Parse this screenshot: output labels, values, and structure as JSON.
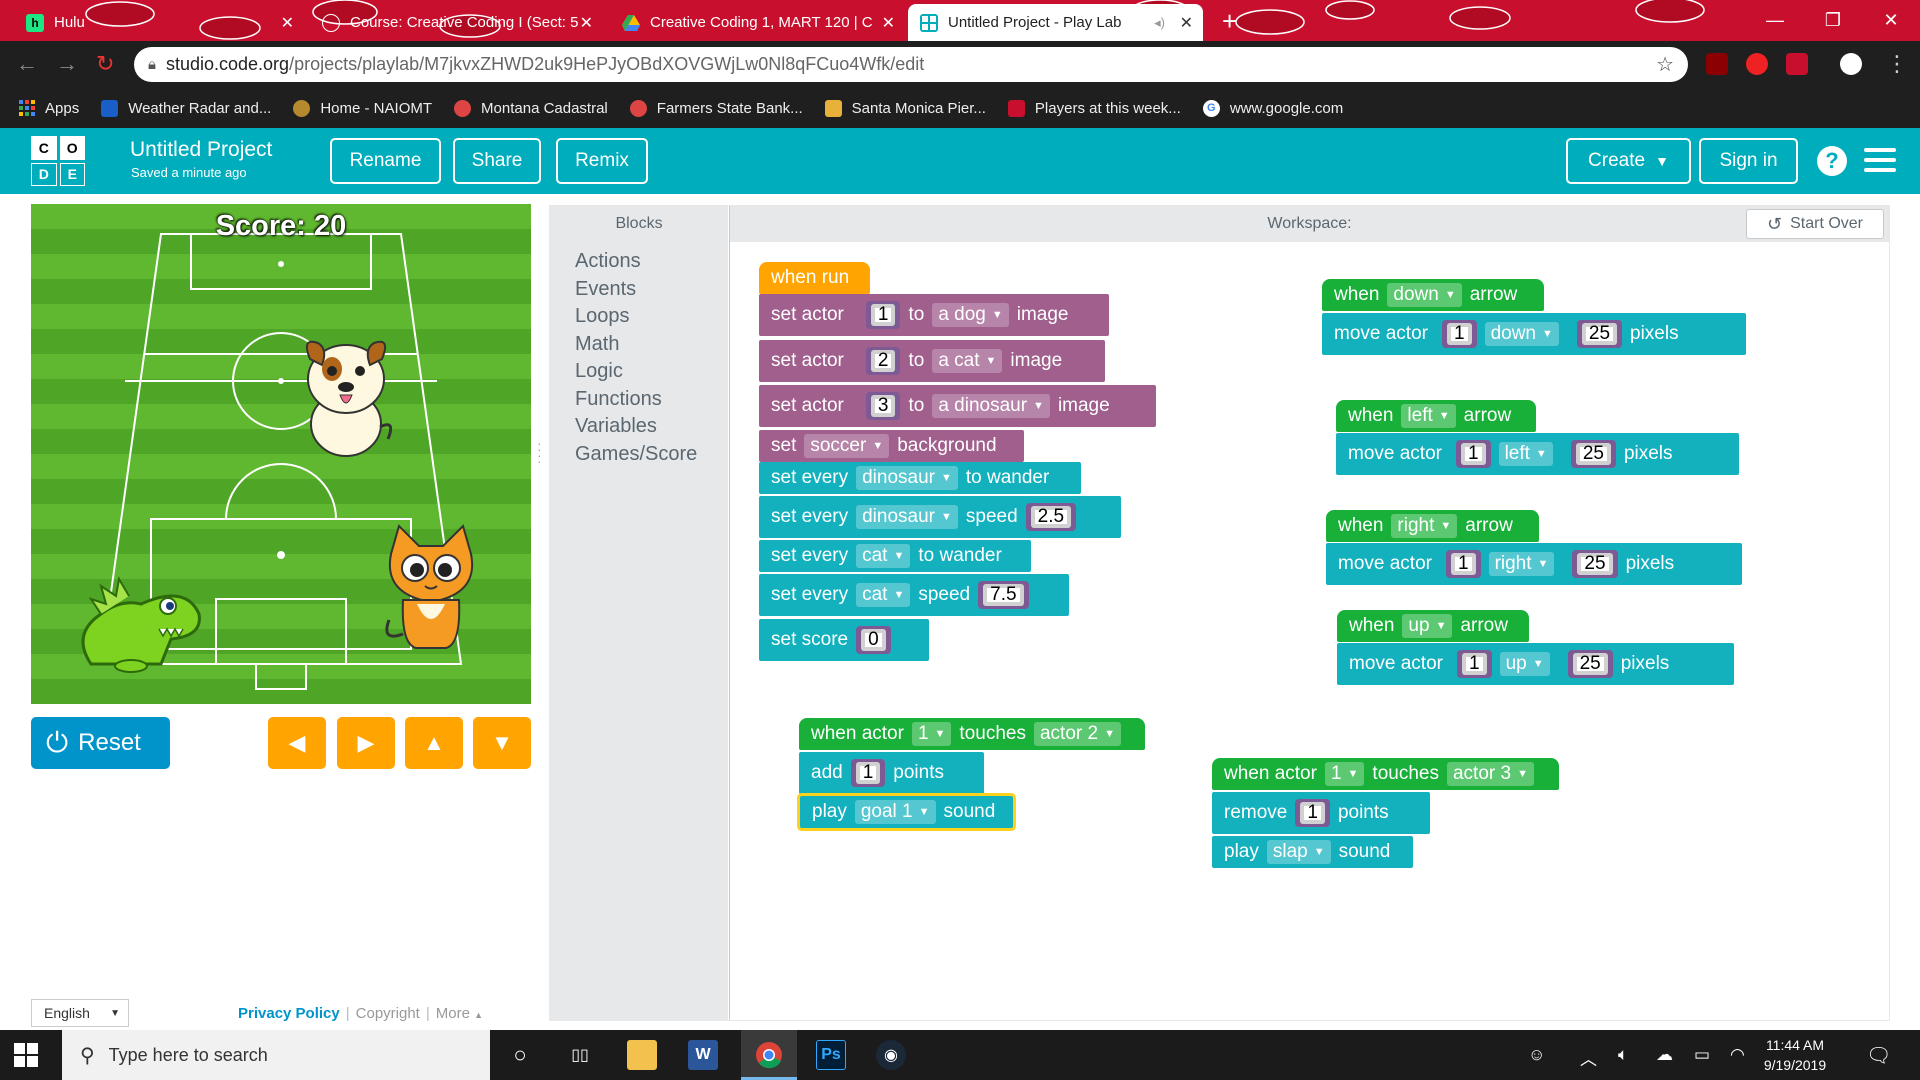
{
  "browser": {
    "tabs": [
      {
        "title": "Hulu",
        "favicon": "hulu-icon",
        "color": "#1ce783"
      },
      {
        "title": "Course: Creative Coding I (Sect: 5",
        "favicon": "course-icon",
        "color": "#c8102e"
      },
      {
        "title": "Creative Coding 1, MART 120 | C",
        "favicon": "drive-icon",
        "color": "#4285f4"
      },
      {
        "title": "Untitled Project - Play Lab",
        "favicon": "codeorg-icon",
        "color": "#00adbc"
      }
    ],
    "url_host": "studio.code.org",
    "url_path": "/projects/playlab/M7jkvxZHWD2uk9HePJyOBdXOVGWjLw0Nl8qFCuo4Wfk/edit",
    "bookmarks": [
      {
        "label": "Apps",
        "icon": "apps-grid-icon",
        "color": "#4285f4"
      },
      {
        "label": "Weather Radar and...",
        "icon": "weather-icon",
        "color": "#1a5ec7"
      },
      {
        "label": "Home - NAIOMT",
        "icon": "naiomt-icon",
        "color": "#b58a2f"
      },
      {
        "label": "Montana Cadastral",
        "icon": "globe-icon",
        "color": "#d44"
      },
      {
        "label": "Farmers State Bank...",
        "icon": "globe-icon",
        "color": "#d44"
      },
      {
        "label": "Santa Monica Pier...",
        "icon": "pier-icon",
        "color": "#e8b23a"
      },
      {
        "label": "Players at this week...",
        "icon": "players-icon",
        "color": "#c8102e"
      },
      {
        "label": "www.google.com",
        "icon": "google-icon",
        "color": "#fff"
      }
    ]
  },
  "header": {
    "logo_letters": [
      "C",
      "O",
      "D",
      "E"
    ],
    "title": "Untitled Project",
    "saved": "Saved a minute ago",
    "rename": "Rename",
    "share": "Share",
    "remix": "Remix",
    "create": "Create",
    "signin": "Sign in",
    "help": "?"
  },
  "stage": {
    "score": "Score: 20",
    "reset": "Reset"
  },
  "toolbox": {
    "title": "Blocks",
    "categories": [
      "Actions",
      "Events",
      "Loops",
      "Math",
      "Logic",
      "Functions",
      "Variables",
      "Games/Score"
    ]
  },
  "workspace": {
    "title": "Workspace:",
    "start_over": "Start Over"
  },
  "blocks": {
    "run": {
      "hat": "when run",
      "b1": {
        "a": "set actor",
        "n": "1",
        "b": "to",
        "dd": "a dog",
        "c": "image"
      },
      "b2": {
        "a": "set actor",
        "n": "2",
        "b": "to",
        "dd": "a cat",
        "c": "image"
      },
      "b3": {
        "a": "set actor",
        "n": "3",
        "b": "to",
        "dd": "a dinosaur",
        "c": "image"
      },
      "b4": {
        "a": "set",
        "dd": "soccer",
        "c": "background"
      },
      "b5": {
        "a": "set every",
        "dd": "dinosaur",
        "c": "to wander"
      },
      "b6": {
        "a": "set every",
        "dd": "dinosaur",
        "c": "speed",
        "n": "2.5"
      },
      "b7": {
        "a": "set every",
        "dd": "cat",
        "c": "to wander"
      },
      "b8": {
        "a": "set every",
        "dd": "cat",
        "c": "speed",
        "n": "7.5"
      },
      "b9": {
        "a": "set score",
        "n": "0"
      }
    },
    "touch1": {
      "a": "when actor",
      "n1": "1",
      "b": "touches",
      "dd": "actor 2",
      "add": "add",
      "n": "1",
      "points": "points",
      "play": "play",
      "sound": "goal 1",
      "sound_lbl": "sound"
    },
    "touch2": {
      "a": "when actor",
      "n1": "1",
      "b": "touches",
      "dd": "actor 3",
      "remove": "remove",
      "n": "1",
      "points": "points",
      "play": "play",
      "sound": "slap",
      "sound_lbl": "sound"
    },
    "arrows": [
      {
        "when": "when",
        "key": "down",
        "arrow": "arrow",
        "move": "move actor",
        "actor": "1",
        "dir": "down",
        "dist": "25",
        "unit": "pixels"
      },
      {
        "when": "when",
        "key": "left",
        "arrow": "arrow",
        "move": "move actor",
        "actor": "1",
        "dir": "left",
        "dist": "25",
        "unit": "pixels"
      },
      {
        "when": "when",
        "key": "right",
        "arrow": "arrow",
        "move": "move actor",
        "actor": "1",
        "dir": "right",
        "dist": "25",
        "unit": "pixels"
      },
      {
        "when": "when",
        "key": "up",
        "arrow": "arrow",
        "move": "move actor",
        "actor": "1",
        "dir": "up",
        "dist": "25",
        "unit": "pixels"
      }
    ]
  },
  "footer": {
    "language": "English",
    "privacy": "Privacy Policy",
    "copyright": "Copyright",
    "more": "More"
  },
  "taskbar": {
    "search_placeholder": "Type here to search",
    "time": "11:44 AM",
    "date": "9/19/2019"
  }
}
